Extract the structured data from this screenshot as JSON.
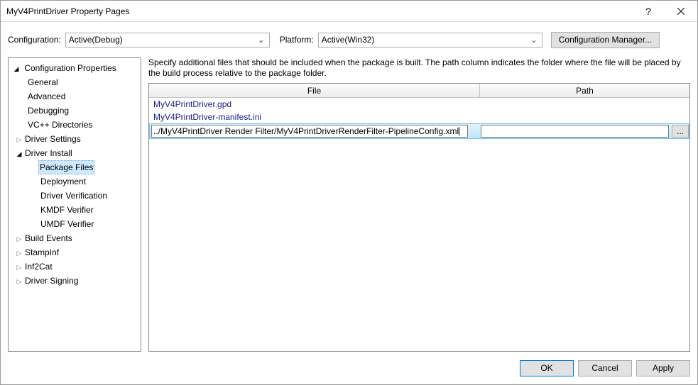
{
  "titlebar": {
    "title": "MyV4PrintDriver Property Pages",
    "help_tooltip": "?",
    "close_tooltip": "Close"
  },
  "configrow": {
    "configuration_label": "Configuration:",
    "configuration_value": "Active(Debug)",
    "platform_label": "Platform:",
    "platform_value": "Active(Win32)",
    "config_manager_label": "Configuration Manager..."
  },
  "tree": {
    "root": "Configuration Properties",
    "general": "General",
    "advanced": "Advanced",
    "debugging": "Debugging",
    "vcdirs": "VC++ Directories",
    "driver_settings": "Driver Settings",
    "driver_install": "Driver Install",
    "package_files": "Package Files",
    "deployment": "Deployment",
    "driver_verification": "Driver Verification",
    "kmdf_verifier": "KMDF Verifier",
    "umdf_verifier": "UMDF Verifier",
    "build_events": "Build Events",
    "stampinf": "StampInf",
    "inf2cat": "Inf2Cat",
    "driver_signing": "Driver Signing"
  },
  "panel": {
    "description": "Specify additional files that should be included when the package is built.  The path column indicates the folder where the file will be placed by the build process relative to the package folder.",
    "col_file": "File",
    "col_path": "Path",
    "rows": [
      {
        "file": "MyV4PrintDriver.gpd",
        "path": ""
      },
      {
        "file": "MyV4PrintDriver-manifest.ini",
        "path": ""
      }
    ],
    "editing": {
      "file": "../MyV4PrintDriver Render Filter/MyV4PrintDriverRenderFilter-PipelineConfig.xml",
      "path": "",
      "browse": "..."
    }
  },
  "buttons": {
    "ok": "OK",
    "cancel": "Cancel",
    "apply": "Apply"
  }
}
